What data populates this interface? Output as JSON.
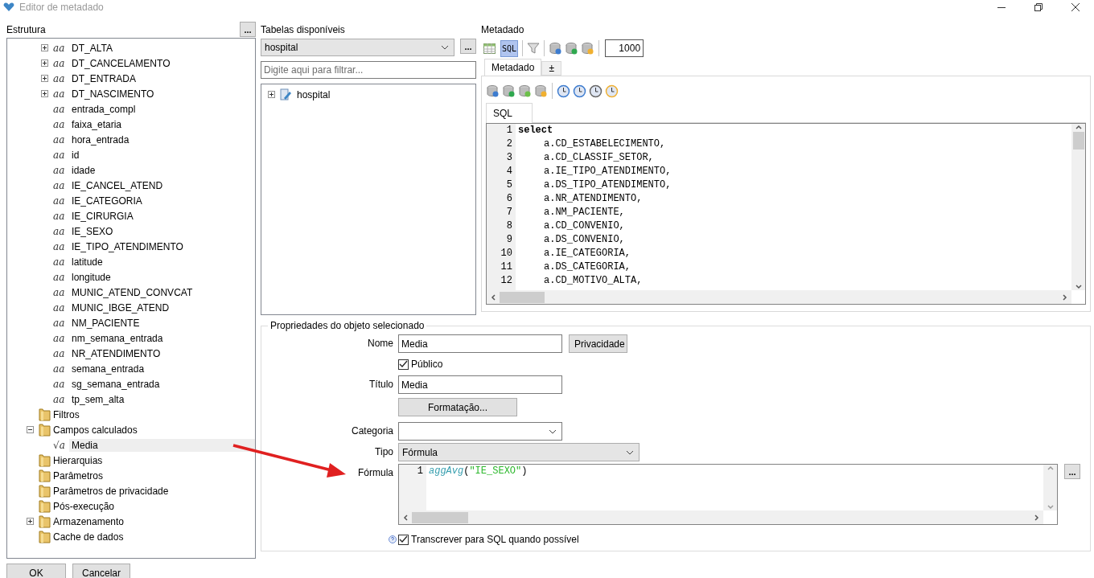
{
  "window": {
    "title": "Editor de metadado"
  },
  "structure": {
    "title": "Estrutura",
    "menu_button": "...",
    "fields": [
      {
        "label": "DT_ALTA",
        "glyph": "aa",
        "expanded": false,
        "selected": false
      },
      {
        "label": "DT_CANCELAMENTO",
        "glyph": "aa",
        "expanded": false,
        "selected": false
      },
      {
        "label": "DT_ENTRADA",
        "glyph": "aa",
        "expanded": false,
        "selected": false
      },
      {
        "label": "DT_NASCIMENTO",
        "glyph": "aa",
        "expanded": false,
        "selected": false
      },
      {
        "label": "entrada_compl",
        "glyph": "aa",
        "selected": false
      },
      {
        "label": "faixa_etaria",
        "glyph": "aa",
        "selected": false
      },
      {
        "label": "hora_entrada",
        "glyph": "aa",
        "selected": false
      },
      {
        "label": "id",
        "glyph": "aa",
        "selected": false
      },
      {
        "label": "idade",
        "glyph": "aa",
        "selected": false
      },
      {
        "label": "IE_CANCEL_ATEND",
        "glyph": "aa",
        "selected": false
      },
      {
        "label": "IE_CATEGORIA",
        "glyph": "aa",
        "selected": false
      },
      {
        "label": "IE_CIRURGIA",
        "glyph": "aa",
        "selected": false
      },
      {
        "label": "IE_SEXO",
        "glyph": "aa",
        "selected": false
      },
      {
        "label": "IE_TIPO_ATENDIMENTO",
        "glyph": "aa",
        "selected": false
      },
      {
        "label": "latitude",
        "glyph": "aa",
        "selected": false
      },
      {
        "label": "longitude",
        "glyph": "aa",
        "selected": false
      },
      {
        "label": "MUNIC_ATEND_CONVCAT",
        "glyph": "aa",
        "selected": false
      },
      {
        "label": "MUNIC_IBGE_ATEND",
        "glyph": "aa",
        "selected": false
      },
      {
        "label": "NM_PACIENTE",
        "glyph": "aa",
        "selected": false
      },
      {
        "label": "nm_semana_entrada",
        "glyph": "aa",
        "selected": false
      },
      {
        "label": "NR_ATENDIMENTO",
        "glyph": "aa",
        "selected": false
      },
      {
        "label": "semana_entrada",
        "glyph": "aa",
        "selected": false
      },
      {
        "label": "sg_semana_entrada",
        "glyph": "aa",
        "selected": false
      },
      {
        "label": "tp_sem_alta",
        "glyph": "aa",
        "selected": false
      }
    ],
    "folders": [
      {
        "label": "Filtros",
        "selected": false
      },
      {
        "label": "Campos calculados",
        "expanded": true,
        "selected": false,
        "children": [
          {
            "label": "Media",
            "glyph": "√a",
            "selected": true
          }
        ]
      },
      {
        "label": "Hierarquias",
        "selected": false
      },
      {
        "label": "Parâmetros",
        "selected": false
      },
      {
        "label": "Parâmetros de privacidade",
        "selected": false
      },
      {
        "label": "Pós-execução",
        "selected": false
      },
      {
        "label": "Armazenamento",
        "expanded": false,
        "selected": false
      },
      {
        "label": "Cache de dados",
        "selected": false
      }
    ]
  },
  "tables": {
    "title": "Tabelas disponíveis",
    "selected_table": "hospital",
    "menu_button": "...",
    "filter": {
      "placeholder": "Digite aqui para filtrar..."
    },
    "tree": [
      {
        "label": "hospital",
        "expanded": false
      }
    ]
  },
  "metadata": {
    "title": "Metadado",
    "view_buttons": [
      {
        "kind": "grid",
        "selected": false
      },
      {
        "kind": "sql",
        "label": "SQL",
        "selected": true
      }
    ],
    "row_limit": "1000",
    "tabs": [
      {
        "label": "Metadado",
        "selected": true
      },
      {
        "label": "±",
        "selected": false
      }
    ],
    "editor_tabs": [
      {
        "label": "SQL",
        "selected": true
      }
    ],
    "sql_lines": [
      {
        "number": "1",
        "kind": "keyword",
        "text": "select"
      },
      {
        "number": "2",
        "kind": "column",
        "text": "a.CD_ESTABELECIMENTO,"
      },
      {
        "number": "3",
        "kind": "column",
        "text": "a.CD_CLASSIF_SETOR,"
      },
      {
        "number": "4",
        "kind": "column",
        "text": "a.IE_TIPO_ATENDIMENTO,"
      },
      {
        "number": "5",
        "kind": "column",
        "text": "a.DS_TIPO_ATENDIMENTO,"
      },
      {
        "number": "6",
        "kind": "column",
        "text": "a.NR_ATENDIMENTO,"
      },
      {
        "number": "7",
        "kind": "column",
        "text": "a.NM_PACIENTE,"
      },
      {
        "number": "8",
        "kind": "column",
        "text": "a.CD_CONVENIO,"
      },
      {
        "number": "9",
        "kind": "column",
        "text": "a.DS_CONVENIO,"
      },
      {
        "number": "10",
        "kind": "column",
        "text": "a.IE_CATEGORIA,"
      },
      {
        "number": "11",
        "kind": "column",
        "text": "a.DS_CATEGORIA,"
      },
      {
        "number": "12",
        "kind": "column",
        "text": "a.CD_MOTIVO_ALTA,"
      }
    ]
  },
  "properties": {
    "title": "Propriedades do objeto selecionado",
    "name": {
      "label": "Nome",
      "value": "Media"
    },
    "privacy_button": "Privacidade",
    "public": {
      "label": "Público",
      "checked": true
    },
    "title_field": {
      "label": "Título",
      "value": "Media"
    },
    "format_button": "Formatação...",
    "category": {
      "label": "Categoria"
    },
    "type": {
      "label": "Tipo",
      "value": "Fórmula"
    },
    "formula": {
      "label": "Fórmula",
      "menu_button": "...",
      "lines": [
        {
          "number": "1",
          "tokens": [
            {
              "kind": "function",
              "text": "aggAvg"
            },
            {
              "kind": "punct",
              "text": "("
            },
            {
              "kind": "string",
              "text": "\"IE_SEXO\""
            },
            {
              "kind": "punct",
              "text": ")"
            }
          ]
        }
      ]
    },
    "transcribe": {
      "label": "Transcrever para SQL quando possível",
      "checked": true
    }
  },
  "buttons": [
    {
      "label": "OK"
    },
    {
      "label": "Cancelar"
    }
  ]
}
